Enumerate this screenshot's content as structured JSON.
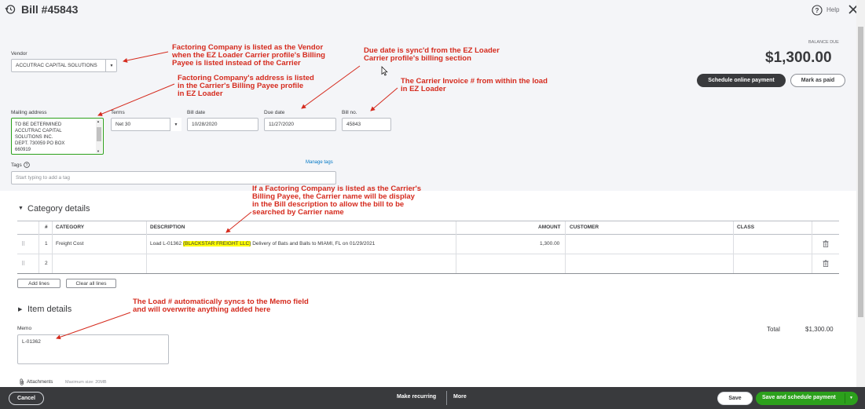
{
  "header": {
    "title": "Bill #45843",
    "help_label": "Help"
  },
  "balance": {
    "label": "BALANCE DUE",
    "amount": "$1,300.00",
    "schedule_btn": "Schedule online payment",
    "mark_paid_btn": "Mark as paid"
  },
  "form": {
    "vendor_label": "Vendor",
    "vendor_value": "ACCUTRAC CAPITAL SOLUTIONS",
    "mailing_label": "Mailing address",
    "mailing_lines": [
      "TO BE DETERMINED",
      "ACCUTRAC CAPITAL",
      "SOLUTIONS INC.",
      "DEPT. 730059 PO BOX",
      "660919"
    ],
    "terms_label": "Terms",
    "terms_value": "Net 30",
    "bill_date_label": "Bill date",
    "bill_date_value": "10/28/2020",
    "due_date_label": "Due date",
    "due_date_value": "11/27/2020",
    "bill_no_label": "Bill no.",
    "bill_no_value": "45843",
    "tags_label": "Tags",
    "manage_tags": "Manage tags",
    "tags_placeholder": "Start typing to add a tag"
  },
  "category": {
    "section_title": "Category details",
    "columns": [
      "#",
      "CATEGORY",
      "DESCRIPTION",
      "AMOUNT",
      "CUSTOMER",
      "CLASS"
    ],
    "rows": [
      {
        "num": "1",
        "category": "Freight Cost",
        "desc_pre": "Load L-01362 ",
        "desc_hl": "(BLACKSTAR FREIGHT LLC)",
        "desc_post": " Delivery of Bats and Balls to MIAMI, FL on 01/29/2021",
        "amount": "1,300.00"
      },
      {
        "num": "2",
        "category": "",
        "desc_pre": "",
        "desc_hl": "",
        "desc_post": "",
        "amount": ""
      }
    ],
    "add_lines": "Add lines",
    "clear_lines": "Clear all lines"
  },
  "item": {
    "section_title": "Item details"
  },
  "memo": {
    "label": "Memo",
    "value": "L-01362"
  },
  "total": {
    "label": "Total",
    "value": "$1,300.00"
  },
  "attachments": {
    "label": "Attachments",
    "max": "Maximum size: 20MB"
  },
  "footer": {
    "cancel": "Cancel",
    "make_recurring": "Make recurring",
    "more": "More",
    "save": "Save",
    "save_schedule": "Save and schedule payment"
  },
  "annotations": {
    "vendor": "Factoring Company is listed as the Vendor\nwhen the EZ Loader Carrier profile's Billing\nPayee is listed instead of the Carrier",
    "address": "Factoring Company's address is listed\nin the Carrier's Billing Payee profile\nin EZ Loader",
    "due_date": "Due date is sync'd from the EZ Loader\nCarrier profile's billing section",
    "invoice": "The Carrier Invoice # from within the load\nin EZ Loader",
    "description": "If a Factoring Company is listed as the Carrier's\nBilling Payee, the Carrier name will be display\nin the Bill description to allow the bill to be\nsearched by Carrier name",
    "memo": "The Load # automatically syncs to the Memo field\nand will overwrite anything added here"
  },
  "colors": {
    "annotation": "#d52b1e",
    "primary_green": "#2ca01c",
    "dark": "#393a3d",
    "highlight": "#ffff00"
  }
}
